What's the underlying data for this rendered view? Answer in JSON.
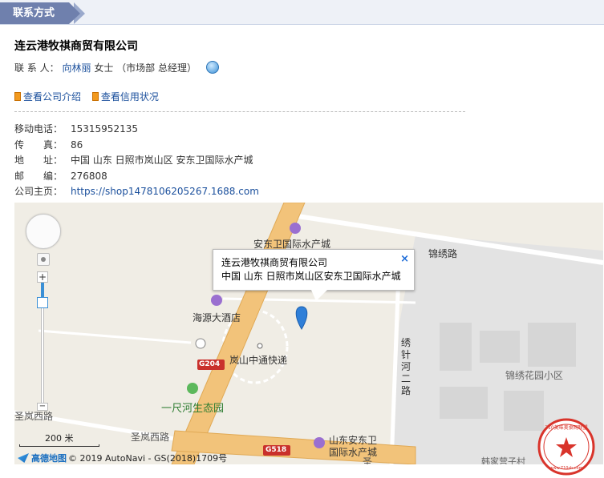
{
  "tab": {
    "title": "联系方式"
  },
  "company": {
    "name": "连云港牧祺商贸有限公司"
  },
  "contact": {
    "label": "联 系 人：",
    "name": "向林丽",
    "suffix": " 女士 （市场部 总经理）"
  },
  "links": {
    "company_intro": "查看公司介绍",
    "credit_status": "查看信用状况"
  },
  "info": [
    {
      "label": "移动电话：",
      "value": "15315952135"
    },
    {
      "label": "传　　真：",
      "value": "86"
    },
    {
      "label": "地　　址：",
      "value": "中国 山东 日照市岚山区 安东卫国际水产城"
    },
    {
      "label": "邮　　编：",
      "value": "276808"
    },
    {
      "label": "公司主页：",
      "value": "https://shop1478106205267.1688.com",
      "is_link": true
    }
  ],
  "map": {
    "popup": {
      "title": "连云港牧祺商贸有限公司",
      "address": "中国 山东 日照市岚山区安东卫国际水产城",
      "close": "×"
    },
    "labels": {
      "market": "安东卫国际水产城",
      "jinxiu_road": "锦绣路",
      "hotel": "海源大酒店",
      "express": "岚山中通快递",
      "g204": "G204",
      "jinxiu_garden": "锦绣花园小区",
      "rd2a": "绣",
      "rd2b": "针",
      "rd2c": "河",
      "rd2d": "二",
      "rd2e": "路",
      "park": "一尺河生态园",
      "shenglan_w": "圣岚西路",
      "shenglan2": "圣岚西路",
      "g518": "G518",
      "sd_andong1": "山东安东卫",
      "sd_andong2": "国际水产城",
      "hanjia": "韩家营子村",
      "sheng": "圣"
    },
    "zoom": {
      "plus": "+",
      "minus": "−"
    },
    "scale": "200 米",
    "copyright": {
      "brand": "高德地图",
      "text": "© 2019 AutoNavi - GS(2018)1709号"
    }
  },
  "stamp": {
    "text": "710美味美食网联盟",
    "url": "www.710zh.com"
  },
  "colors": {
    "tab": "#6f80ad",
    "link": "#1a4f9c",
    "road": "#f2c37a",
    "pin": "#2f7fd8"
  }
}
